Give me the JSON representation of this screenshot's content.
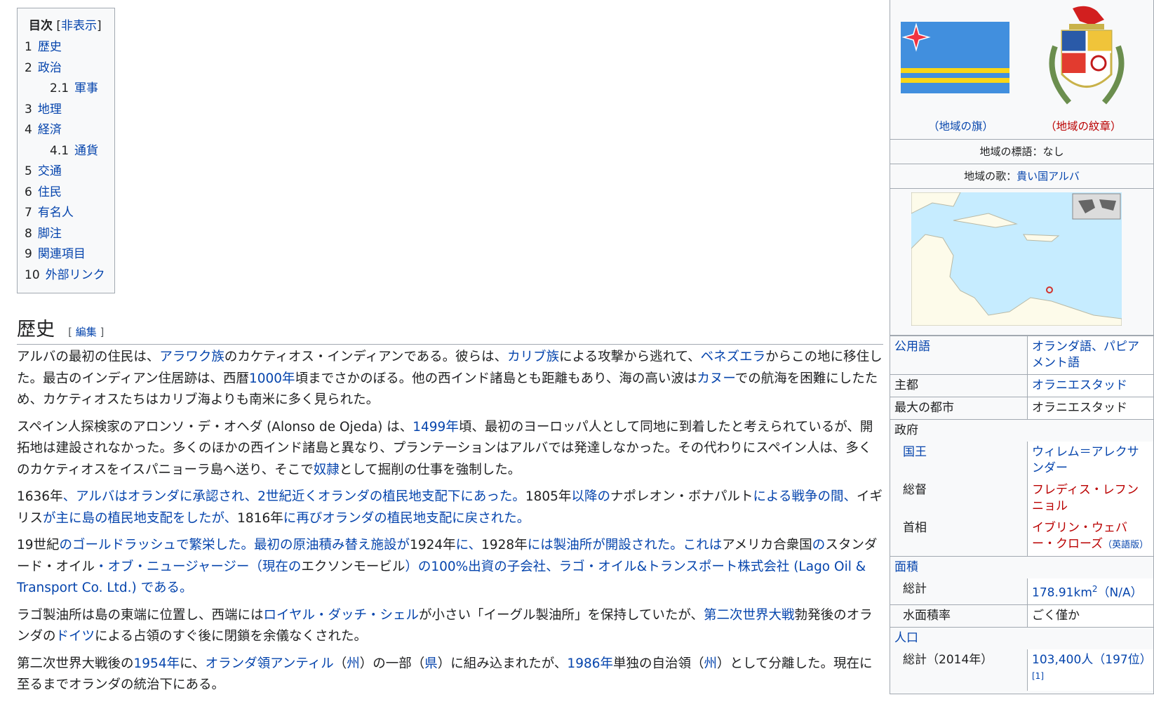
{
  "toc": {
    "title": "目次",
    "toggle": "非表示",
    "items": [
      {
        "num": "1",
        "label": "歴史"
      },
      {
        "num": "2",
        "label": "政治"
      },
      {
        "num": "2.1",
        "label": "軍事"
      },
      {
        "num": "3",
        "label": "地理"
      },
      {
        "num": "4",
        "label": "経済"
      },
      {
        "num": "4.1",
        "label": "通貨"
      },
      {
        "num": "5",
        "label": "交通"
      },
      {
        "num": "6",
        "label": "住民"
      },
      {
        "num": "7",
        "label": "有名人"
      },
      {
        "num": "8",
        "label": "脚注"
      },
      {
        "num": "9",
        "label": "関連項目"
      },
      {
        "num": "10",
        "label": "外部リンク"
      }
    ]
  },
  "section": {
    "title": "歴史",
    "edit": "編集"
  },
  "article": {
    "p1": [
      "アルバの最初の住民は、",
      "アラワク族",
      "のカケティオス・インディアンである。彼らは、",
      "カリブ族",
      "による攻撃から逃れて、",
      "ベネズエラ",
      "からこの地に移住した。最古のインディアン住居跡は、西暦",
      "1000年",
      "頃までさかのぼる。他の西インド諸島とも距離もあり、海の高い波は",
      "カヌー",
      "での航海を困難にしたため、カケティオスたちはカリブ海よりも南米に多く見られた。"
    ],
    "p2": [
      "スペイン人探検家のアロンソ・デ・オヘダ (Alonso de Ojeda) は、",
      "1499年",
      "頃、最初のヨーロッパ人として同地に到着したと考えられているが、開拓地は建設されなかった。多くのほかの西インド諸島と異なり、プランテーションはアルバでは発達しなかった。その代わりにスペイン人は、多くのカケティオスをイスパニョーラ島へ送り、そこで",
      "奴隷",
      "として掘削の仕事を強制した。"
    ],
    "p3": [
      "1636年",
      "、アルバはオランダに承認され、2世紀近くオランダの植民地支配下にあった。",
      "1805年",
      "以降の",
      "ナポレオン・ボナパルト",
      "による戦争の間、",
      "イギリス",
      "が主に島の植民地支配をしたが、",
      "1816年",
      "に再びオランダの植民地支配に戻された。"
    ],
    "p4": [
      "19世紀",
      "のゴールドラッシュで繁栄した。最初の原油積み替え施設が",
      "1924年",
      "に、",
      "1928年",
      "には製油所が開設された。これは",
      "アメリカ合衆国",
      "の",
      "スタンダード・オイル",
      "・オブ・ニュージャージー（現在の",
      "エクソンモービル",
      "）の100%出資の子会社、ラゴ・オイル&トランスポート株式会社 (Lago Oil & Transport Co. Ltd.) である。"
    ],
    "p5": [
      "ラゴ製油所は島の東端に位置し、西端には",
      "ロイヤル・ダッチ・シェル",
      "が小さい「イーグル製油所」を保持していたが、",
      "第二次世界大戦",
      "勃発後のオランダの",
      "ドイツ",
      "による占領のすぐ後に閉鎖を余儀なくされた。"
    ],
    "p6": [
      "第二次世界大戦後の",
      "1954年",
      "に、",
      "オランダ領アンティル",
      "（",
      "州",
      "）の一部（",
      "県",
      "）に組み込まれたが、",
      "1986年",
      "単独の自治領（",
      "州",
      "）として分離した。現在に至るまでオランダの統治下にある。"
    ]
  },
  "infobox": {
    "flag_caption": "（地域の旗）",
    "coat_caption": "（地域の紋章）",
    "motto": "地域の標語：なし",
    "anthem_label": "地域の歌：",
    "anthem_link": "貴い国アルバ",
    "rows": {
      "official_lang_label": "公用語",
      "official_lang_value": "オランダ語、パピアメント語",
      "capital_label": "主都",
      "capital_value": "オラニエスタッド",
      "largest_label": "最大の都市",
      "largest_value": "オラニエスタッド",
      "gov_label": "政府",
      "king_label": "国王",
      "king_value": "ウィレム＝アレクサンダー",
      "governor_label": "総督",
      "governor_value": "フレディス・レフンニョル",
      "pm_label": "首相",
      "pm_value": "イブリン・ウェバー・クローズ",
      "pm_note": "（英語版）",
      "area_label": "面積",
      "area_total_label": "総計",
      "area_total_value": "178.91km",
      "area_total_sup": "2",
      "area_total_rank": "（N/A）",
      "water_label": "水面積率",
      "water_value": "ごく僅か",
      "pop_label": "人口",
      "pop_total_label": "総計（2014年）",
      "pop_total_value": "103,400人（197位）",
      "pop_ref": "[1]"
    }
  },
  "colors": {
    "link": "#0645ad",
    "redlink": "#ba0000",
    "flag_blue": "#418fde",
    "flag_yellow": "#f9d616",
    "flag_star": "#ef3340"
  }
}
